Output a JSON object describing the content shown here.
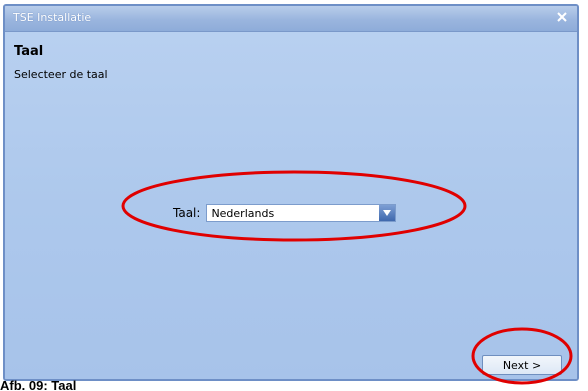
{
  "window": {
    "title": "TSE Installatie",
    "close_symbol": "×"
  },
  "page": {
    "heading": "Taal",
    "subtitle": "Selecteer de taal"
  },
  "language": {
    "label": "Taal:",
    "selected": "Nederlands"
  },
  "buttons": {
    "next_label": "Next >"
  },
  "caption": {
    "text": "Afb. 09: Taal"
  },
  "colors": {
    "annotation": "#e00000",
    "window_bg": "#adc8ec",
    "titlebar": "#9ab5de",
    "dropdown_button": "#3f68ad"
  },
  "icons": {
    "close": "close-icon",
    "dropdown": "chevron-down-icon"
  }
}
